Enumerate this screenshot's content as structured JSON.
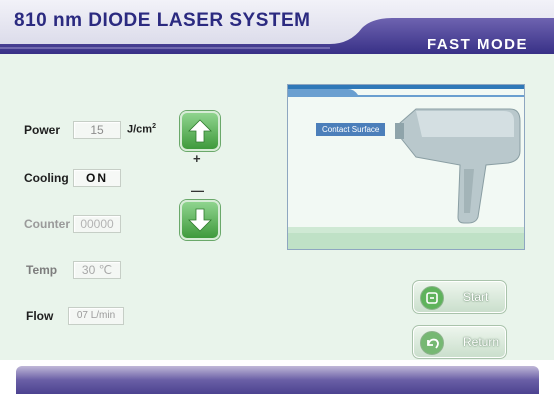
{
  "header": {
    "title": "810 nm DIODE LASER SYSTEM",
    "mode": "FAST MODE"
  },
  "params": {
    "power": {
      "label": "Power",
      "value": "15",
      "unit": "J/cm",
      "unit_sup": "2"
    },
    "cooling": {
      "label": "Cooling",
      "value": "ON"
    },
    "counter": {
      "label": "Counter",
      "value": "00000"
    },
    "temp": {
      "label": "Temp",
      "value": "30 ℃"
    },
    "flow": {
      "label": "Flow",
      "value": "07 L/min"
    }
  },
  "adjust": {
    "plus": "+",
    "minus": "—"
  },
  "image_panel": {
    "callout": "Contact Surface"
  },
  "actions": {
    "start": "Start",
    "return": "Return"
  },
  "colors": {
    "accent": "#2b2a80",
    "header_band": "#3a3180",
    "body_bg": "#e9f4eb",
    "button_green": "#3f9a3c"
  },
  "icons": [
    "up-arrow-icon",
    "down-arrow-icon",
    "start-icon",
    "return-icon"
  ]
}
